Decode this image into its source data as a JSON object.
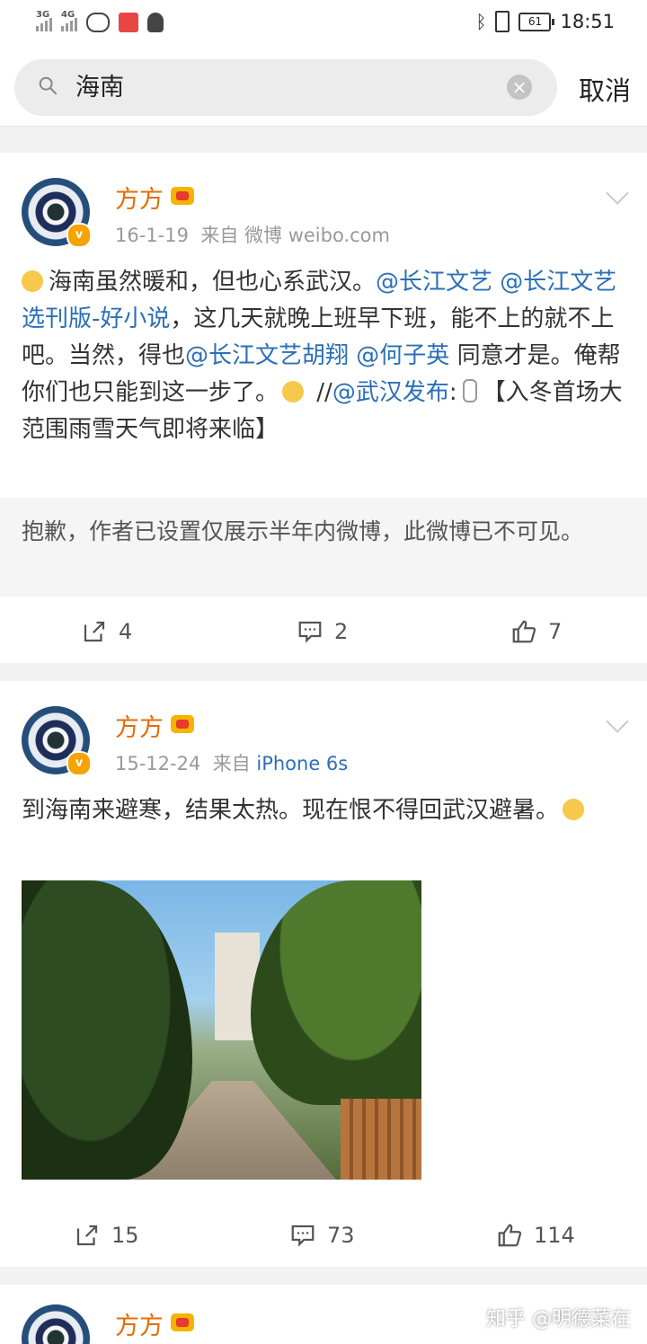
{
  "status_bar": {
    "network1": "3G",
    "network2": "4G",
    "battery": "61",
    "time": "18:51",
    "icons": [
      "weibo-icon",
      "app-icon",
      "qq-icon",
      "bluetooth-icon",
      "vibrate-icon"
    ]
  },
  "search": {
    "query": "海南",
    "cancel_label": "取消"
  },
  "posts": [
    {
      "author": "方方",
      "date": "16-1-19",
      "source_prefix": "来自",
      "source": "微博 weibo.com",
      "text_parts": [
        {
          "t": "海南虽然暖和，但也心系武汉。",
          "link": false
        },
        {
          "t": "@长江文艺",
          "link": true
        },
        {
          "t": " ",
          "link": false
        },
        {
          "t": "@长江文艺选刊版-好小说",
          "link": true
        },
        {
          "t": "，这几天就晚上班早下班，能不上的就不上吧。当然，得也",
          "link": false
        },
        {
          "t": "@长江文艺胡翔",
          "link": true
        },
        {
          "t": " ",
          "link": false
        },
        {
          "t": "@何子英",
          "link": true
        },
        {
          "t": " 同意才是。俺帮你们也只能到这一步了。",
          "link": false
        },
        {
          "t": " //",
          "link": false
        },
        {
          "t": "@武汉发布",
          "link": true
        },
        {
          "t": ":",
          "link": false
        },
        {
          "t": "【入冬首场大范围雨雪天气即将来临】",
          "link": false
        }
      ],
      "repost_notice": "抱歉，作者已设置仅展示半年内微博，此微博已不可见。",
      "reposts": "4",
      "comments": "2",
      "likes": "7"
    },
    {
      "author": "方方",
      "date": "15-12-24",
      "source_prefix": "来自",
      "source": "iPhone 6s",
      "text": "到海南来避寒，结果太热。现在恨不得回武汉避暑。",
      "reposts": "15",
      "comments": "73",
      "likes": "114"
    },
    {
      "author": "方方"
    }
  ],
  "watermark": "知乎 @明德菜在"
}
